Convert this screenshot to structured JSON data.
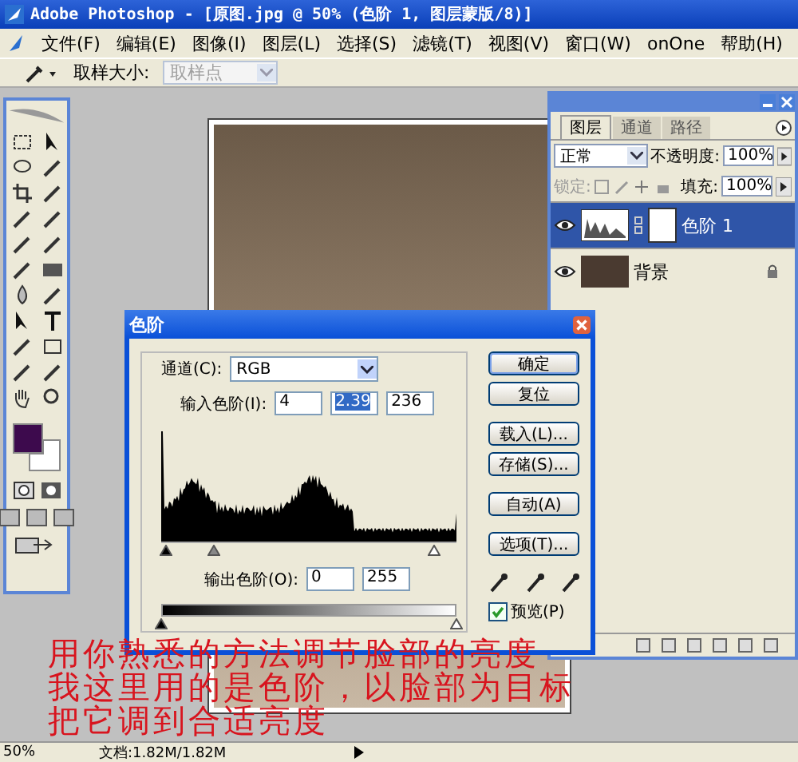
{
  "window": {
    "title": "Adobe Photoshop - [原图.jpg @ 50% (色阶 1, 图层蒙版/8)]"
  },
  "menu": [
    "文件(F)",
    "编辑(E)",
    "图像(I)",
    "图层(L)",
    "选择(S)",
    "滤镜(T)",
    "视图(V)",
    "窗口(W)",
    "onOne",
    "帮助(H)"
  ],
  "options_bar": {
    "label": "取样大小:",
    "dropdown": {
      "value": "取样点",
      "disabled": true
    }
  },
  "layers_panel": {
    "tabs": [
      {
        "label": "图层",
        "selected": true
      },
      {
        "label": "通道",
        "selected": false
      },
      {
        "label": "路径",
        "selected": false
      }
    ],
    "blend_mode": "正常",
    "opacity_label": "不透明度:",
    "opacity": "100%",
    "lock_label": "锁定:",
    "fill_label": "填充:",
    "fill": "100%",
    "layers": [
      {
        "name": "色阶 1",
        "kind": "adjustment",
        "selected": true,
        "visible": true,
        "locked": false
      },
      {
        "name": "背景",
        "kind": "image",
        "selected": false,
        "visible": true,
        "locked": true
      }
    ]
  },
  "levels_dialog": {
    "title": "色阶",
    "channel_label": "通道(C):",
    "channel": "RGB",
    "input_label": "输入色阶(I):",
    "inputs": [
      {
        "value": "4",
        "selected": false
      },
      {
        "value": "2.39",
        "selected": true
      },
      {
        "value": "236",
        "selected": false
      }
    ],
    "input_sliders": [
      {
        "kind": "black",
        "level": 0.016
      },
      {
        "kind": "gray",
        "level": 0.18
      },
      {
        "kind": "white",
        "level": 0.925
      }
    ],
    "output_label": "输出色阶(O):",
    "outputs": [
      "0",
      "255"
    ],
    "output_sliders": [
      {
        "kind": "black",
        "level": 0
      },
      {
        "kind": "white",
        "level": 1
      }
    ],
    "buttons": [
      {
        "label": "确定",
        "default": true
      },
      {
        "label": "复位",
        "default": false
      },
      {
        "label": "载入(L)...",
        "default": false
      },
      {
        "label": "存储(S)...",
        "default": false
      },
      {
        "label": "自动(A)",
        "default": false
      },
      {
        "label": "选项(T)...",
        "default": false
      }
    ],
    "preview": {
      "label": "预览(P)",
      "checked": true
    }
  },
  "annotation": [
    "用你熟悉的方法调节脸部的亮度",
    "我这里用的是色阶，以脸部为目标",
    "把它调到合适亮度"
  ],
  "status_bar": {
    "zoom": "50%",
    "doc": "文档:1.82M/1.82M"
  }
}
